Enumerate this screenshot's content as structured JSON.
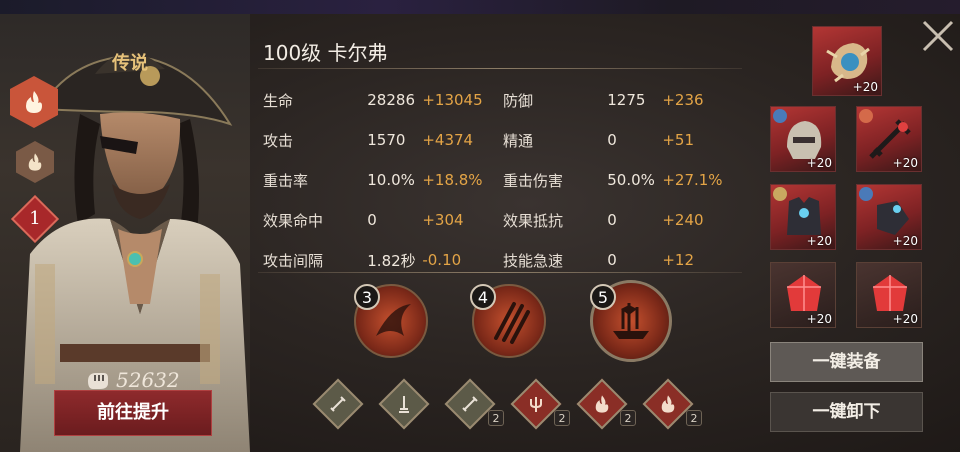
{
  "hero": {
    "rarity": "传说",
    "title": "100级  卡尔弗",
    "power": "52632",
    "star_level": "1",
    "upgrade_label": "前往提升"
  },
  "stats": [
    {
      "name": "生命",
      "value": "28286",
      "bonus": "+13045",
      "name2": "防御",
      "value2": "1275",
      "bonus2": "+236"
    },
    {
      "name": "攻击",
      "value": "1570",
      "bonus": "+4374",
      "name2": "精通",
      "value2": "0",
      "bonus2": "+51"
    },
    {
      "name": "重击率",
      "value": "10.0%",
      "bonus": "+18.8%",
      "name2": "重击伤害",
      "value2": "50.0%",
      "bonus2": "+27.1%"
    },
    {
      "name": "效果命中",
      "value": "0",
      "bonus": "+304",
      "name2": "效果抵抗",
      "value2": "0",
      "bonus2": "+240"
    },
    {
      "name": "攻击间隔",
      "value": "1.82秒",
      "bonus": "-0.10",
      "name2": "技能急速",
      "value2": "0",
      "bonus2": "+12"
    }
  ],
  "skills": [
    {
      "num": "3",
      "icon": "flame-slash-icon"
    },
    {
      "num": "4",
      "icon": "daggers-icon"
    },
    {
      "num": "5",
      "icon": "ship-icon"
    }
  ],
  "runes": [
    {
      "icon": "sword-icon",
      "count": ""
    },
    {
      "icon": "sword-stand-icon",
      "count": ""
    },
    {
      "icon": "sword-icon",
      "count": "2"
    },
    {
      "icon": "trident-icon",
      "count": "2"
    },
    {
      "icon": "fire-icon",
      "count": "2"
    },
    {
      "icon": "fire-icon",
      "count": "2"
    }
  ],
  "equipment": {
    "relic": {
      "level": "+20",
      "icon": "shell-icon"
    },
    "slots": [
      {
        "level": "+20",
        "icon": "helmet-icon"
      },
      {
        "level": "+20",
        "icon": "weapon-icon"
      },
      {
        "level": "+20",
        "icon": "armor-icon"
      },
      {
        "level": "+20",
        "icon": "gauntlet-icon"
      },
      {
        "level": "+20",
        "icon": "red-gem-icon"
      },
      {
        "level": "+20",
        "icon": "red-gem-icon"
      }
    ]
  },
  "buttons": {
    "equip_all": "一键装备",
    "unequip_all": "一键卸下"
  },
  "colors": {
    "accent": "#e3a446",
    "legend_red": "#8e2a2c",
    "fire": "#c9553a"
  }
}
